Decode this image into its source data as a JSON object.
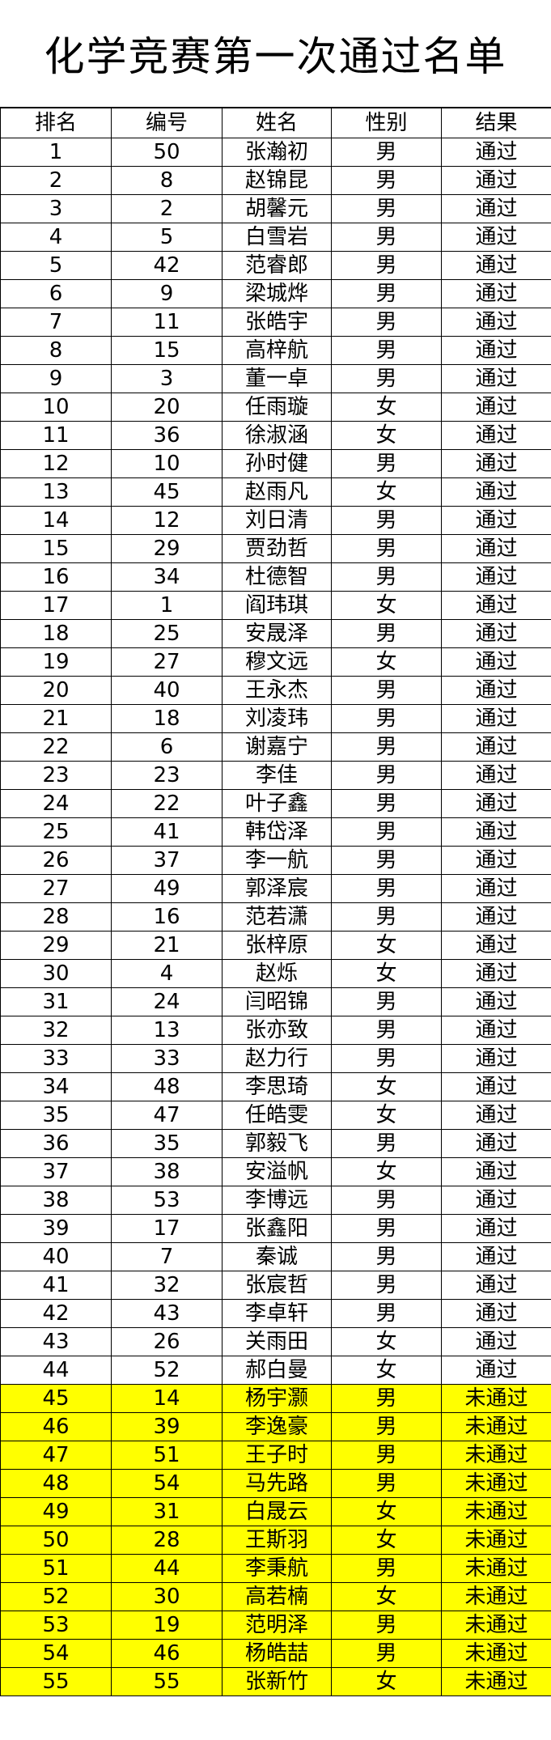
{
  "title": "化学竞赛第一次通过名单",
  "headers": [
    "排名",
    "编号",
    "姓名",
    "性别",
    "结果"
  ],
  "colors": {
    "fail_highlight": "#ffff00",
    "border": "#000000"
  },
  "rows": [
    [
      "1",
      "50",
      "张瀚初",
      "男",
      "通过"
    ],
    [
      "2",
      "8",
      "赵锦昆",
      "男",
      "通过"
    ],
    [
      "3",
      "2",
      "胡馨元",
      "男",
      "通过"
    ],
    [
      "4",
      "5",
      "白雪岩",
      "男",
      "通过"
    ],
    [
      "5",
      "42",
      "范睿郎",
      "男",
      "通过"
    ],
    [
      "6",
      "9",
      "梁城烨",
      "男",
      "通过"
    ],
    [
      "7",
      "11",
      "张皓宇",
      "男",
      "通过"
    ],
    [
      "8",
      "15",
      "高梓航",
      "男",
      "通过"
    ],
    [
      "9",
      "3",
      "董一卓",
      "男",
      "通过"
    ],
    [
      "10",
      "20",
      "任雨璇",
      "女",
      "通过"
    ],
    [
      "11",
      "36",
      "徐淑涵",
      "女",
      "通过"
    ],
    [
      "12",
      "10",
      "孙时健",
      "男",
      "通过"
    ],
    [
      "13",
      "45",
      "赵雨凡",
      "女",
      "通过"
    ],
    [
      "14",
      "12",
      "刘日清",
      "男",
      "通过"
    ],
    [
      "15",
      "29",
      "贾劲哲",
      "男",
      "通过"
    ],
    [
      "16",
      "34",
      "杜德智",
      "男",
      "通过"
    ],
    [
      "17",
      "1",
      "阎玮琪",
      "女",
      "通过"
    ],
    [
      "18",
      "25",
      "安晟泽",
      "男",
      "通过"
    ],
    [
      "19",
      "27",
      "穆文远",
      "女",
      "通过"
    ],
    [
      "20",
      "40",
      "王永杰",
      "男",
      "通过"
    ],
    [
      "21",
      "18",
      "刘凌玮",
      "男",
      "通过"
    ],
    [
      "22",
      "6",
      "谢嘉宁",
      "男",
      "通过"
    ],
    [
      "23",
      "23",
      "李佳",
      "男",
      "通过"
    ],
    [
      "24",
      "22",
      "叶子鑫",
      "男",
      "通过"
    ],
    [
      "25",
      "41",
      "韩岱泽",
      "男",
      "通过"
    ],
    [
      "26",
      "37",
      "李一航",
      "男",
      "通过"
    ],
    [
      "27",
      "49",
      "郭泽宸",
      "男",
      "通过"
    ],
    [
      "28",
      "16",
      "范若潇",
      "男",
      "通过"
    ],
    [
      "29",
      "21",
      "张梓原",
      "女",
      "通过"
    ],
    [
      "30",
      "4",
      "赵烁",
      "女",
      "通过"
    ],
    [
      "31",
      "24",
      "闫昭锦",
      "男",
      "通过"
    ],
    [
      "32",
      "13",
      "张亦致",
      "男",
      "通过"
    ],
    [
      "33",
      "33",
      "赵力行",
      "男",
      "通过"
    ],
    [
      "34",
      "48",
      "李思琦",
      "女",
      "通过"
    ],
    [
      "35",
      "47",
      "任皓雯",
      "女",
      "通过"
    ],
    [
      "36",
      "35",
      "郭毅飞",
      "男",
      "通过"
    ],
    [
      "37",
      "38",
      "安溢帆",
      "女",
      "通过"
    ],
    [
      "38",
      "53",
      "李博远",
      "男",
      "通过"
    ],
    [
      "39",
      "17",
      "张鑫阳",
      "男",
      "通过"
    ],
    [
      "40",
      "7",
      "秦诚",
      "男",
      "通过"
    ],
    [
      "41",
      "32",
      "张宸哲",
      "男",
      "通过"
    ],
    [
      "42",
      "43",
      "李卓轩",
      "男",
      "通过"
    ],
    [
      "43",
      "26",
      "关雨田",
      "女",
      "通过"
    ],
    [
      "44",
      "52",
      "郝白曼",
      "女",
      "通过"
    ],
    [
      "45",
      "14",
      "杨宇灏",
      "男",
      "未通过"
    ],
    [
      "46",
      "39",
      "李逸豪",
      "男",
      "未通过"
    ],
    [
      "47",
      "51",
      "王子时",
      "男",
      "未通过"
    ],
    [
      "48",
      "54",
      "马先路",
      "男",
      "未通过"
    ],
    [
      "49",
      "31",
      "白晟云",
      "女",
      "未通过"
    ],
    [
      "50",
      "28",
      "王斯羽",
      "女",
      "未通过"
    ],
    [
      "51",
      "44",
      "李秉航",
      "男",
      "未通过"
    ],
    [
      "52",
      "30",
      "高若楠",
      "女",
      "未通过"
    ],
    [
      "53",
      "19",
      "范明泽",
      "男",
      "未通过"
    ],
    [
      "54",
      "46",
      "杨皓喆",
      "男",
      "未通过"
    ],
    [
      "55",
      "55",
      "张新竹",
      "女",
      "未通过"
    ]
  ]
}
